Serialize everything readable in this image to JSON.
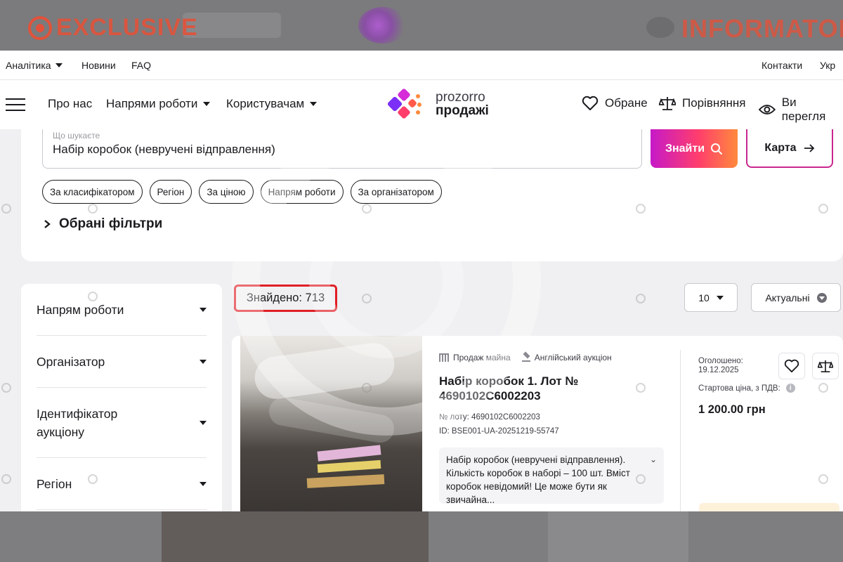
{
  "watermarks": {
    "left": "EXCLUSIVE",
    "right": "INFORMATOR"
  },
  "utilnav": {
    "items": [
      {
        "label": "Аналітика",
        "dropdown": true
      },
      {
        "label": "Новини",
        "dropdown": false
      },
      {
        "label": "FAQ",
        "dropdown": false
      }
    ],
    "right": [
      {
        "label": "Контакти"
      },
      {
        "label": "Укр"
      }
    ]
  },
  "mainnav": {
    "items": [
      {
        "label": "Про нас",
        "dropdown": false
      },
      {
        "label": "Напрями роботи",
        "dropdown": true
      },
      {
        "label": "Користувачам",
        "dropdown": true
      }
    ],
    "logo": {
      "line1": "prozorro",
      "line2": "продажі"
    },
    "right": [
      {
        "label": "Обране",
        "icon": "heart-icon"
      },
      {
        "label": "Порівняння",
        "icon": "scales-icon"
      },
      {
        "label": "Ви перегля",
        "icon": "eye-icon"
      }
    ]
  },
  "search": {
    "placeholder": "Що шукаєте",
    "value": "Набір коробок (невручені відправлення)",
    "find_label": "Знайти",
    "map_label": "Карта"
  },
  "chips": [
    "За класифікатором",
    "Регіон",
    "За ціною",
    "Напрям роботи",
    "За організатором"
  ],
  "selected_filters": "Обрані фільтри",
  "sidebar": {
    "groups": [
      "Напрям роботи",
      "Організатор",
      "Ідентифікатор аукціону",
      "Регіон"
    ]
  },
  "results": {
    "found": "Знайдено: 713",
    "per_page": "10",
    "sort": "Актуальні"
  },
  "card": {
    "tag1": "Продаж майна",
    "tag2": "Англійський аукціон",
    "title": "Набір коробок 1. Лот № 4690102С6002203",
    "lot": "№ лоту: 4690102С6002203",
    "id": "ID: BSE001-UA-20251219-55747",
    "description": "Набір коробок (невручені відправлення). Кількість коробок в наборі – 100 шт. Вміст коробок невідомий! Це може бути як звичайна...",
    "announced_label": "Оголошено:",
    "announced_date": "19.12.2025",
    "price_label": "Стартова ціна, з ПДВ:",
    "price": "1 200.00 грн"
  },
  "colors": {
    "accent_gradient": [
      "#c619c9",
      "#ff3e6c",
      "#ff8a3d"
    ],
    "highlight_border": "#e01f26",
    "watermark": "#e2523a"
  }
}
